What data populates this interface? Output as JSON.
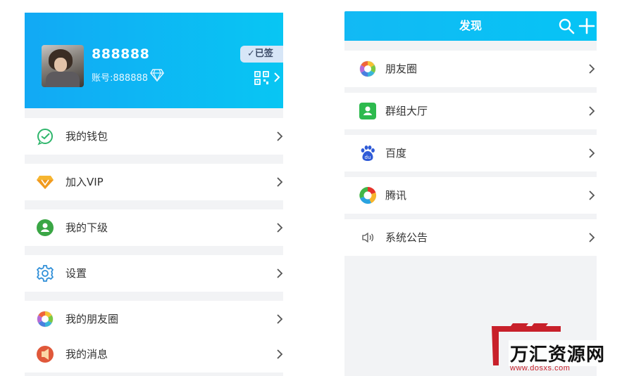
{
  "profile": {
    "username": "888888",
    "account_label": "账号:888888",
    "signed_label": "✓已签",
    "diamond_icon": "diamond-icon",
    "qr_icon": "qr-code-icon"
  },
  "menu": [
    {
      "label": "我的钱包",
      "icon": "wallet-icon"
    },
    {
      "label": "加入VIP",
      "icon": "vip-diamond-icon"
    },
    {
      "label": "我的下级",
      "icon": "subordinate-icon"
    },
    {
      "label": "设置",
      "icon": "gear-icon"
    },
    {
      "label": "我的朋友圈",
      "icon": "moments-icon"
    },
    {
      "label": "我的消息",
      "icon": "message-icon"
    }
  ],
  "discover": {
    "title": "发现",
    "items": [
      {
        "label": "朋友圈",
        "icon": "moments-icon"
      },
      {
        "label": "群组大厅",
        "icon": "group-hall-icon"
      },
      {
        "label": "百度",
        "icon": "baidu-icon"
      },
      {
        "label": "腾讯",
        "icon": "tencent-news-icon"
      },
      {
        "label": "系统公告",
        "icon": "speaker-icon"
      }
    ]
  },
  "watermark": {
    "name": "万汇资源网",
    "url": "www.dosxs.com"
  },
  "colors": {
    "header_gradient_start": "#12a9f4",
    "header_gradient_end": "#08c6f3",
    "page_bg": "#f2f3f5",
    "watermark_red": "#c8202a"
  }
}
